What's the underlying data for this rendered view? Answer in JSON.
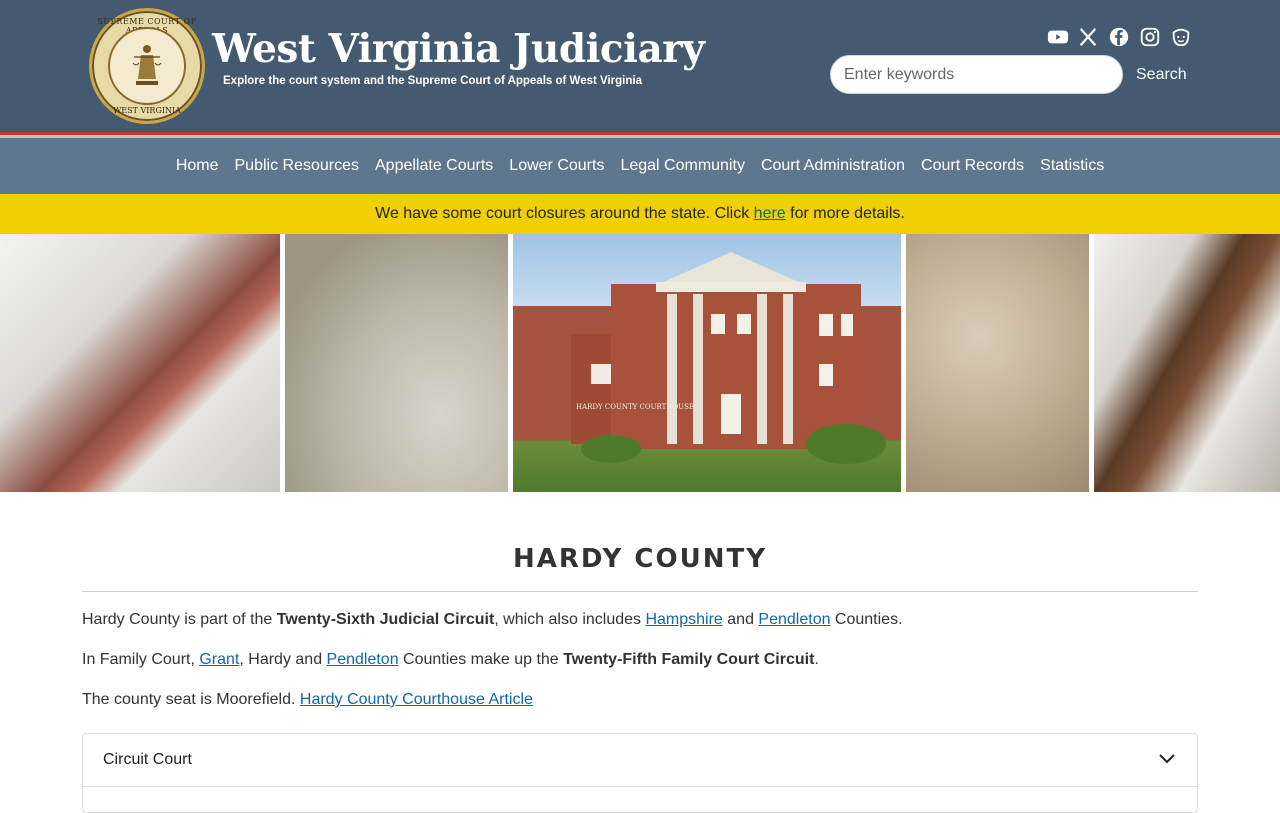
{
  "header": {
    "title": "West Virginia Judiciary",
    "tagline": "Explore the court system and the Supreme Court of Appeals of West Virginia",
    "seal_top_text": "SUPREME COURT OF APPEALS",
    "seal_bottom_text": "WEST VIRGINIA",
    "social_icons": [
      "youtube-icon",
      "x-icon",
      "facebook-icon",
      "instagram-icon",
      "threads-icon"
    ],
    "search": {
      "placeholder": "Enter keywords",
      "button_label": "Search"
    }
  },
  "nav": {
    "items": [
      {
        "label": "Home"
      },
      {
        "label": "Public Resources"
      },
      {
        "label": "Appellate Courts"
      },
      {
        "label": "Lower Courts"
      },
      {
        "label": "Legal Community"
      },
      {
        "label": "Court Administration"
      },
      {
        "label": "Court Records"
      },
      {
        "label": "Statistics"
      }
    ]
  },
  "alert": {
    "before": "We have some court closures around the state. Click ",
    "link": "here",
    "after": " for more details."
  },
  "banner": {
    "courthouse_sign": "HARDY COUNTY COURTHOUSE"
  },
  "main": {
    "page_title": "HARDY COUNTY",
    "p1": {
      "t1": "Hardy County is part of the ",
      "b1": "Twenty-Sixth Judicial Circuit",
      "t2": ", which also includes ",
      "l1": "Hampshire",
      "t3": " and ",
      "l2": "Pendleton",
      "t4": " Counties."
    },
    "p2": {
      "t1": "In Family Court, ",
      "l1": "Grant",
      "t2": ", Hardy and ",
      "l2": "Pendleton",
      "t3": " Counties make up the ",
      "b1": "Twenty-Fifth Family Court Circuit",
      "t4": "."
    },
    "p3": {
      "t1": "The county seat is Moorefield. ",
      "l1": "Hardy County Courthouse Article"
    },
    "accordion": {
      "items": [
        {
          "label": "Circuit Court"
        }
      ]
    }
  },
  "colors": {
    "header_bg": "#435a70",
    "nav_bg": "#5e778f",
    "alert_bg": "#f0d000",
    "accent_red": "#c0392b",
    "link": "#1366a9"
  }
}
